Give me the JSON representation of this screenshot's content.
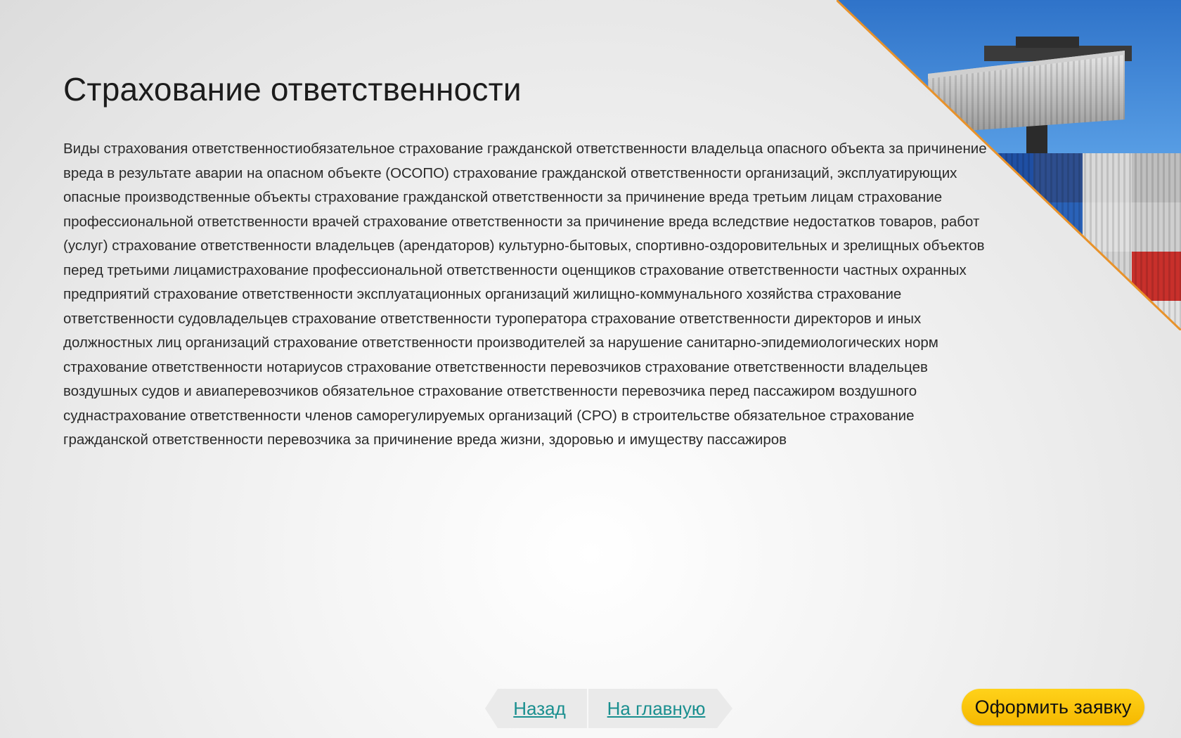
{
  "page": {
    "title": "Страхование ответственности",
    "body": "Виды страхования ответственностиобязательное страхование гражданской ответственности владельца опасного объекта за причинение вреда в результате аварии на опасном объекте (ОСОПО) страхование гражданской ответственности организаций, эксплуатирующих опасные производственные объекты  страхование гражданской ответственности за причинение вреда третьим лицам  страхование профессиональной ответственности врачей страхование ответственности за причинение вреда вследствие недостатков товаров, работ (услуг)  страхование ответственности владельцев (арендаторов) культурно-бытовых, спортивно-оздоровительных и зрелищных объектов перед третьими лицамистрахование профессиональной ответственности оценщиков страхование ответственности частных охранных предприятий страхование ответственности эксплуатационных организаций жилищно-коммунального хозяйства страхование ответственности судовладельцев страхование ответственности туроператора  страхование ответственности директоров и иных должностных лиц организаций страхование ответственности производителей за нарушение санитарно-эпидемиологических норм страхование ответственности нотариусов  страхование ответственности перевозчиков  страхование ответственности владельцев воздушных судов и авиаперевозчиков  обязательное страхование ответственности перевозчика перед пассажиром воздушного суднастрахование ответственности членов саморегулируемых организаций (СРО) в строительстве обязательное страхование гражданской ответственности перевозчика за причинение вреда жизни, здоровью и имуществу пассажиров"
  },
  "nav": {
    "back_label": "Назад",
    "home_label": "На главную"
  },
  "cta": {
    "order_label": "Оформить заявку"
  },
  "colors": {
    "link": "#1a8f8f",
    "cta": "#ffc800",
    "accent_line": "#e8922a",
    "sky": "#3a86d6"
  }
}
